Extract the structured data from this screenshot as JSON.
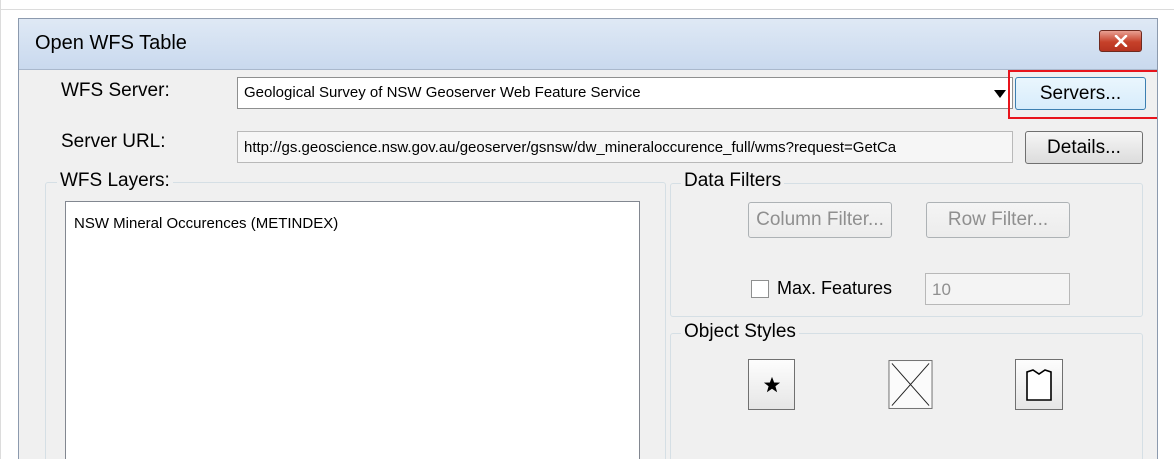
{
  "dialog": {
    "title": "Open WFS Table",
    "close_icon": "close-x-icon"
  },
  "server": {
    "label": "WFS Server:",
    "selected": "Geological Survey of NSW Geoserver Web Feature Service",
    "servers_button": "Servers..."
  },
  "url": {
    "label": "Server URL:",
    "value": "http://gs.geoscience.nsw.gov.au/geoserver/gsnsw/dw_mineraloccurence_full/wms?request=GetCa",
    "details_button": "Details..."
  },
  "layers": {
    "title": "WFS Layers:",
    "items": [
      "NSW Mineral Occurences (METINDEX)"
    ]
  },
  "filters": {
    "title": "Data Filters",
    "column_filter": "Column Filter...",
    "row_filter": "Row Filter...",
    "max_features_label": "Max. Features",
    "max_features_checked": false,
    "max_features_value": "10"
  },
  "styles": {
    "title": "Object Styles",
    "buttons": [
      {
        "icon": "point-symbol-icon"
      },
      {
        "icon": "line-style-icon"
      },
      {
        "icon": "region-style-icon"
      }
    ]
  },
  "colors": {
    "highlight": "#e8141c",
    "close_button": "#c6412a",
    "dialog_bg": "#f0f0f0"
  }
}
